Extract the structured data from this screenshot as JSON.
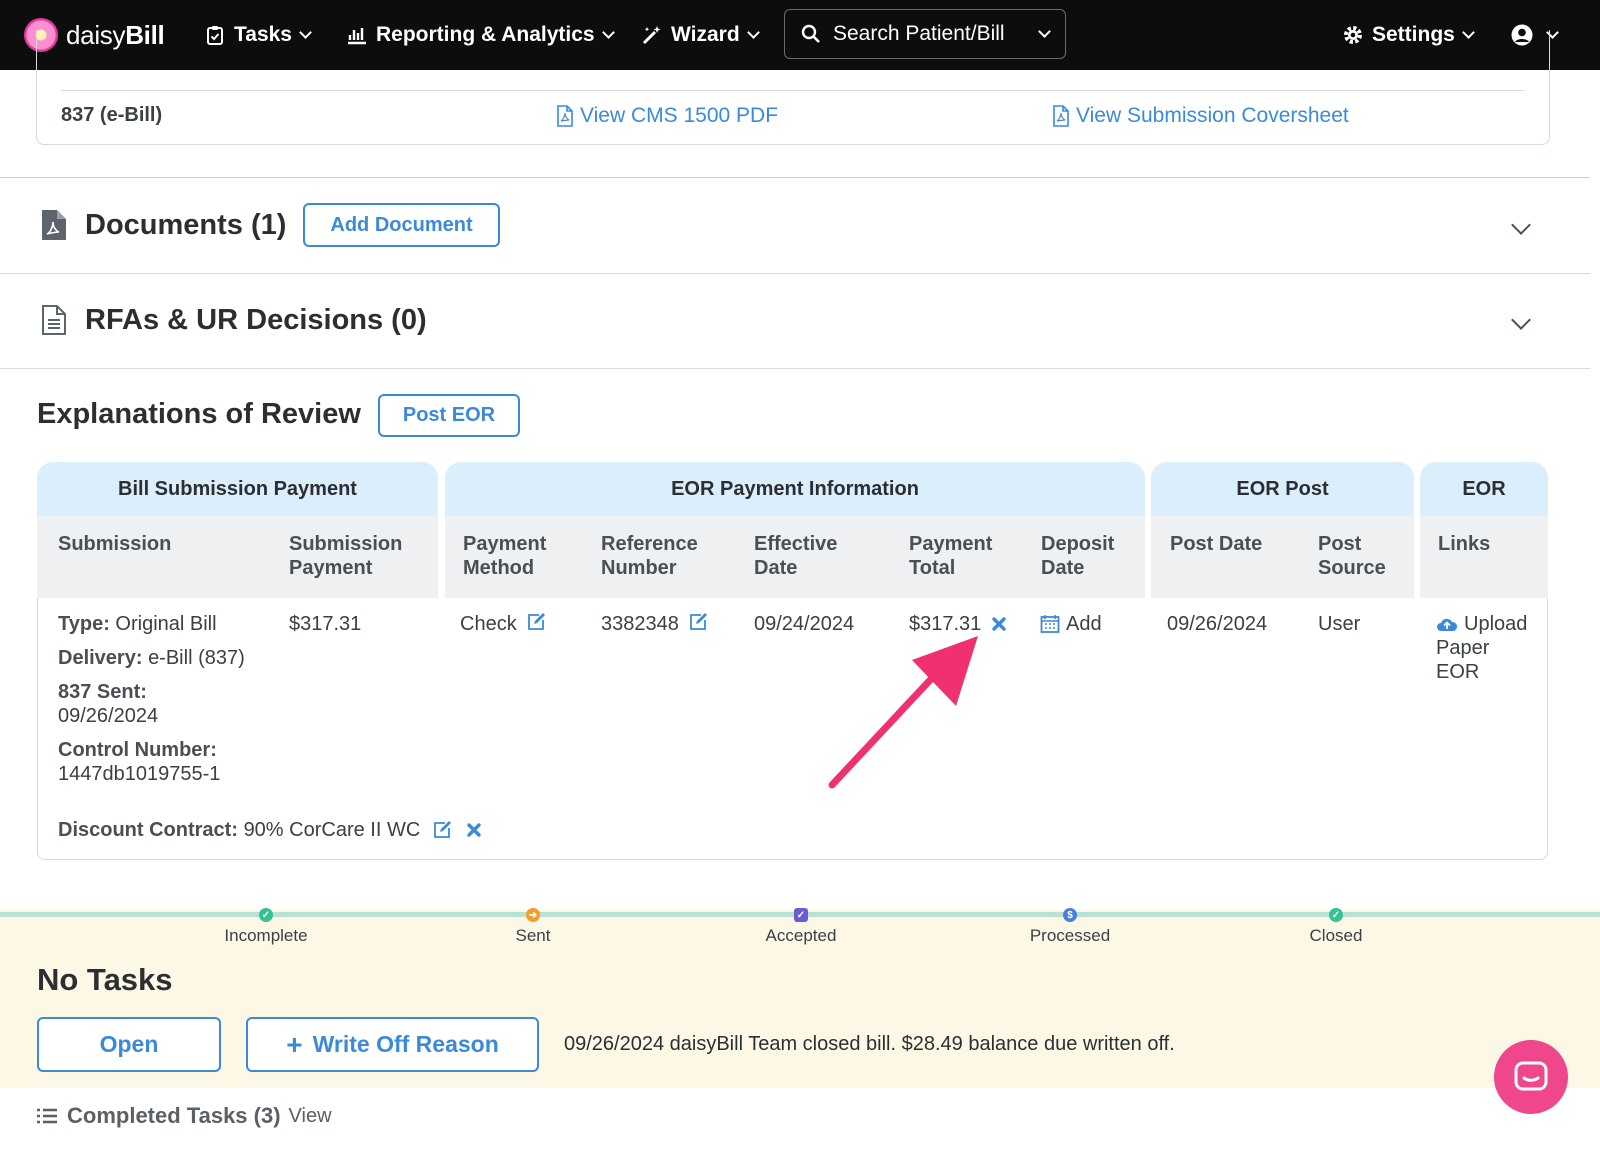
{
  "colors": {
    "brand_dark": "#0d0d0d",
    "link_blue": "#3b8ad9",
    "group_header_bg": "#dbeefb",
    "status_bg": "#fdf8e6",
    "arrow_pink": "#f0306f",
    "chat_pink": "#f0468c"
  },
  "nav": {
    "logo": "daisyBill",
    "tasks": "Tasks",
    "reporting": "Reporting & Analytics",
    "wizard": "Wizard",
    "search_placeholder": "Search Patient/Bill",
    "settings": "Settings"
  },
  "submission_card": {
    "row_label": "837 (e-Bill)",
    "view_pdf": "View CMS 1500 PDF",
    "view_coversheet": "View Submission Coversheet"
  },
  "documents": {
    "title": "Documents (1)",
    "add_button": "Add Document"
  },
  "rfas": {
    "title": "RFAs & UR Decisions (0)"
  },
  "eor": {
    "title": "Explanations of Review",
    "post_button": "Post EOR",
    "groups": [
      "Bill Submission Payment",
      "EOR Payment Information",
      "EOR Post",
      "EOR"
    ],
    "columns": {
      "submission": "Submission",
      "submission_payment_1": "Submission",
      "submission_payment_2": "Payment",
      "payment_method_1": "Payment",
      "payment_method_2": "Method",
      "reference_number_1": "Reference",
      "reference_number_2": "Number",
      "effective_date_1": "Effective",
      "effective_date_2": "Date",
      "payment_total_1": "Payment",
      "payment_total_2": "Total",
      "deposit_date_1": "Deposit",
      "deposit_date_2": "Date",
      "post_date": "Post Date",
      "post_source_1": "Post",
      "post_source_2": "Source",
      "links": "Links"
    },
    "row": {
      "type_label": "Type:",
      "type_value": "Original Bill",
      "delivery_label": "Delivery:",
      "delivery_value": "e-Bill (837)",
      "sent_label": "837 Sent:",
      "sent_value": "09/26/2024",
      "control_label": "Control Number:",
      "control_value": "1447db1019755-1",
      "submission_payment": "$317.31",
      "payment_method": "Check",
      "reference_number": "3382348",
      "effective_date": "09/24/2024",
      "payment_total": "$317.31",
      "deposit_add": "Add",
      "post_date": "09/26/2024",
      "post_source": "User",
      "link_upload_1": "Upload",
      "link_upload_2": "Paper",
      "link_upload_3": "EOR",
      "discount_label": "Discount Contract:",
      "discount_value": "90% CorCare II WC"
    }
  },
  "status_steps": [
    "Incomplete",
    "Sent",
    "Accepted",
    "Processed",
    "Closed"
  ],
  "tasks": {
    "heading": "No Tasks",
    "open_button": "Open",
    "write_off_button": "Write Off Reason",
    "activity": "09/26/2024 daisyBill Team closed bill. $28.49 balance due written off.",
    "completed_label": "Completed Tasks (3)",
    "completed_view": "View"
  }
}
